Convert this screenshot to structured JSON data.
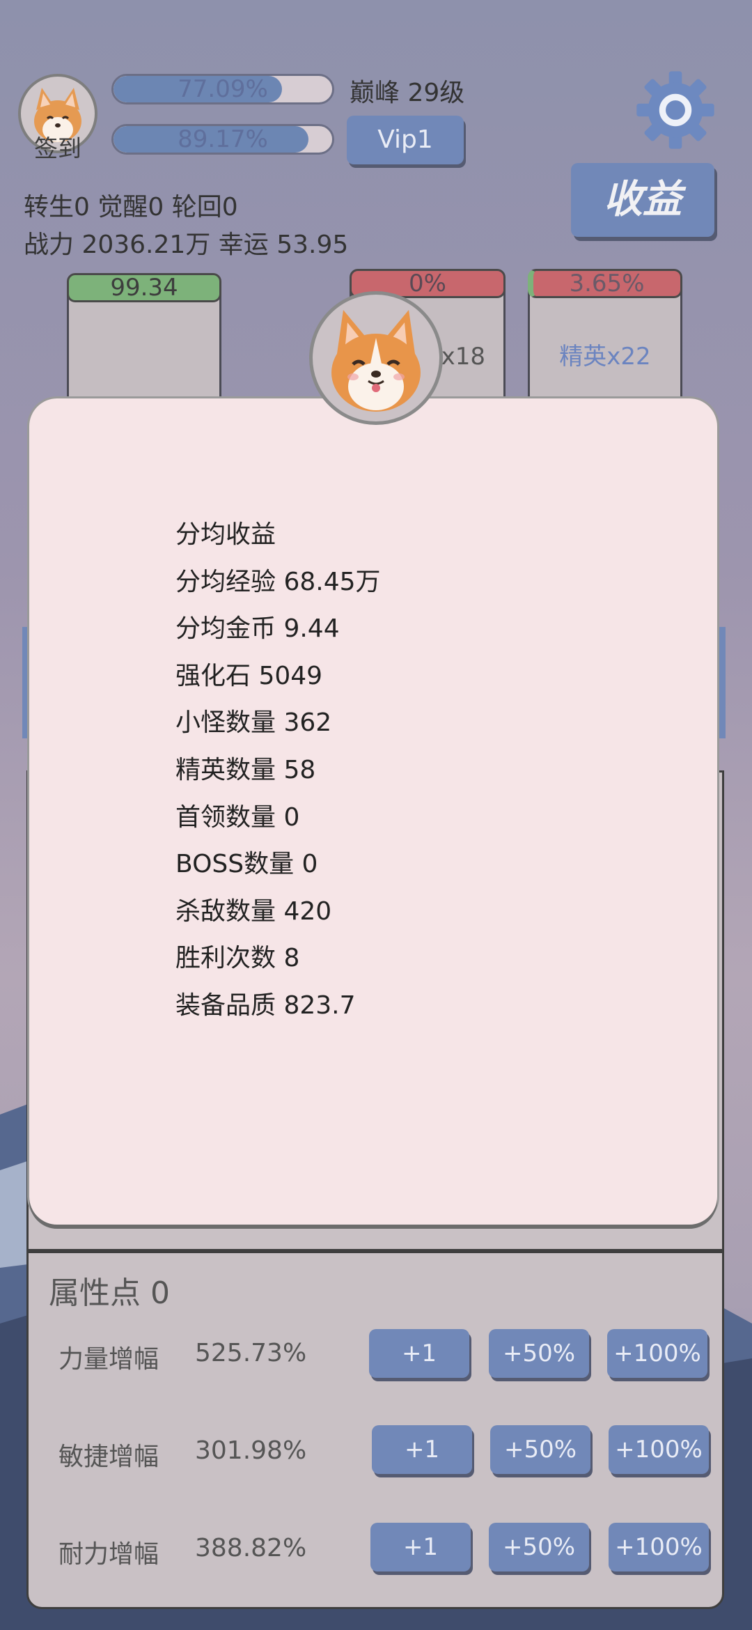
{
  "header": {
    "checkin_label": "签到",
    "exp_bar": {
      "text": "77.09%",
      "value": 0.7709
    },
    "second_bar": {
      "text": "89.17%",
      "value": 0.8917
    },
    "peak_level": "巅峰 29级",
    "vip_label": "Vip1",
    "income_button": "收益",
    "rebirth_line": "转生0 觉醒0 轮回0",
    "power_line": "战力 2036.21万  幸运 53.95"
  },
  "cards": [
    {
      "bar_text": "99.34",
      "bar_value": 1.0,
      "bar_color": "#7db27a",
      "label": ""
    },
    {
      "bar_text": "0%",
      "bar_value": 0.0,
      "bar_color": "#c8676d",
      "label": "怪x18"
    },
    {
      "bar_text": "3.65%",
      "bar_value": 0.0365,
      "bar_color": "#c8676d",
      "label": "精英x22"
    }
  ],
  "dialog": {
    "lines": [
      "分均收益",
      "分均经验 68.45万",
      "分均金币 9.44",
      "强化石  5049",
      "小怪数量 362",
      "精英数量 58",
      "首领数量 0",
      "BOSS数量 0",
      "杀敌数量  420",
      "胜利次数  8",
      "装备品质  823.7"
    ]
  },
  "attributes": {
    "title": "属性点 0",
    "rows": [
      {
        "name": "力量增幅",
        "value": "525.73%"
      },
      {
        "name": "敏捷增幅",
        "value": "301.98%"
      },
      {
        "name": "耐力增幅",
        "value": "388.82%"
      }
    ],
    "buttons": [
      "+1",
      "+50%",
      "+100%"
    ]
  },
  "colors": {
    "button_blue": "#7188b8",
    "dialog_bg": "#f6e5e7",
    "green": "#7db27a",
    "red": "#c8676d"
  }
}
